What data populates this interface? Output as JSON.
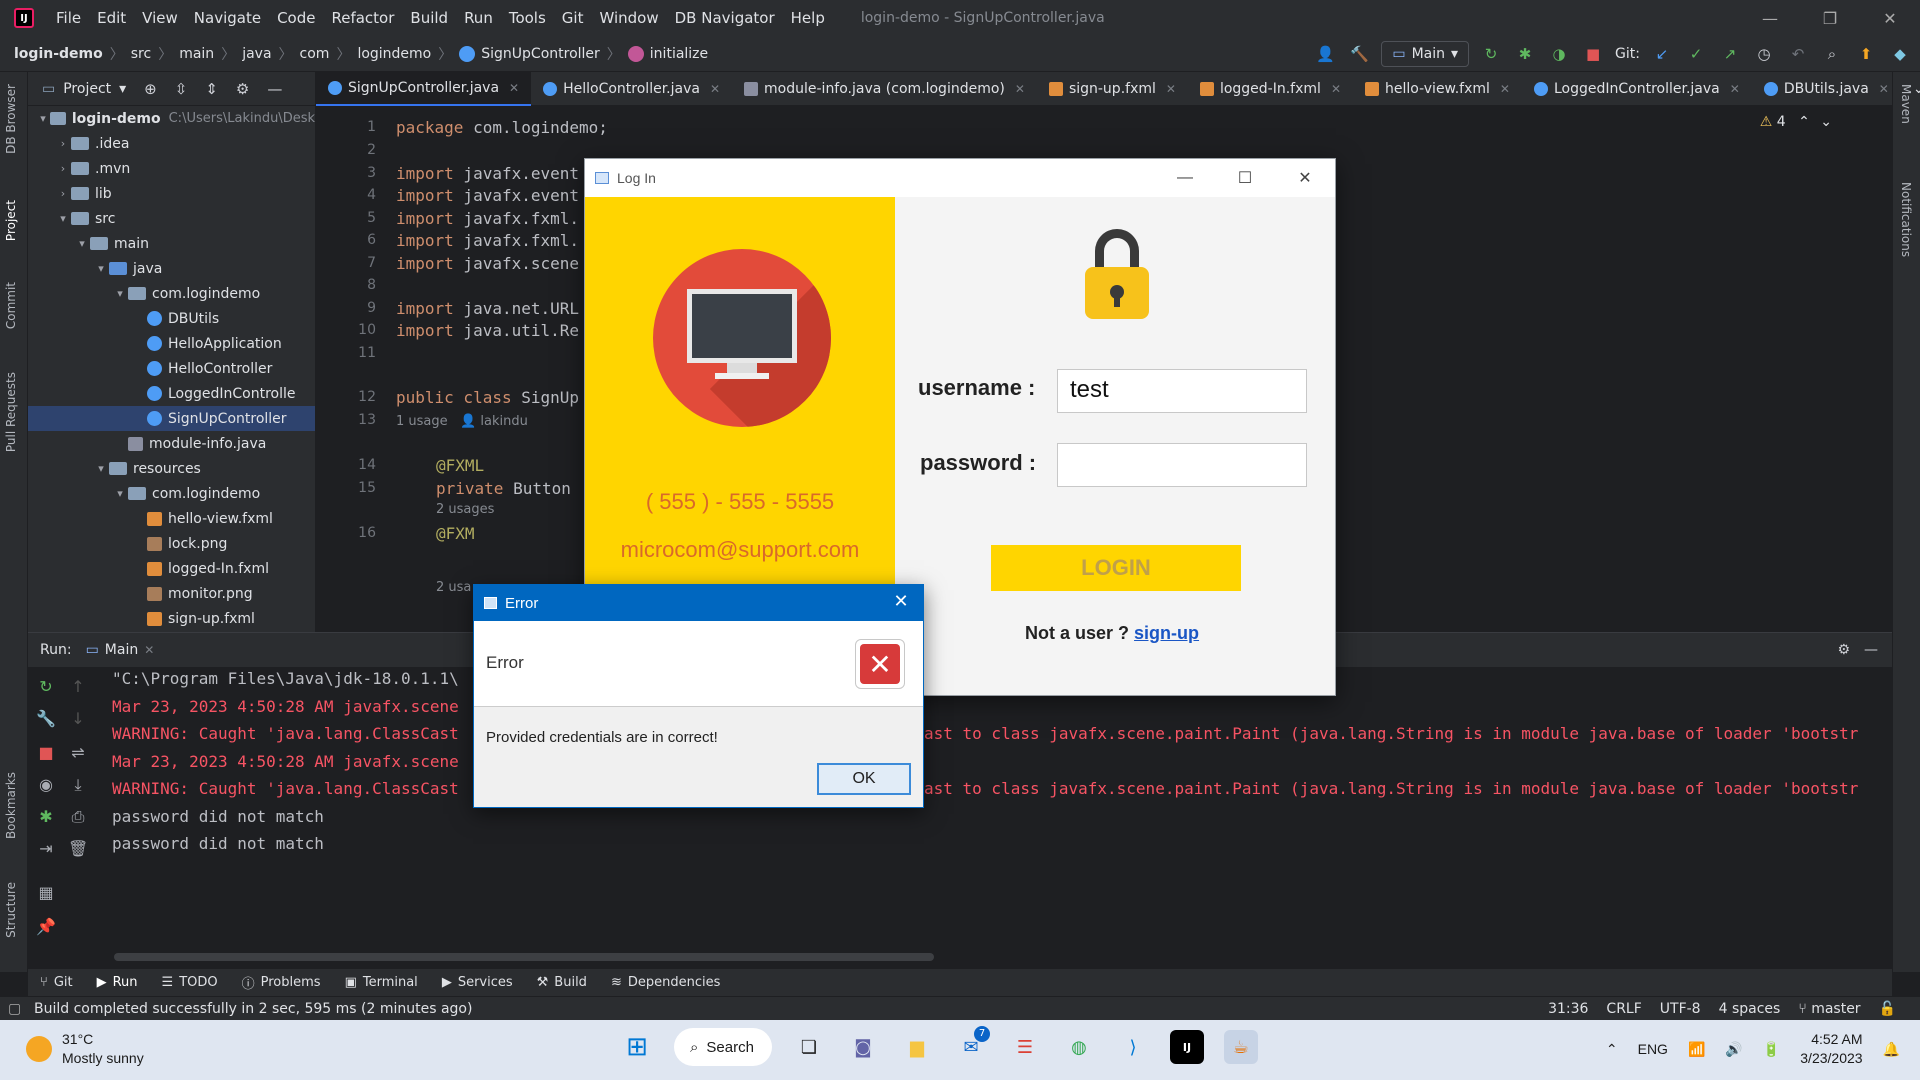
{
  "titlebar": {
    "app_icon": "IJ",
    "menu": [
      "File",
      "Edit",
      "View",
      "Navigate",
      "Code",
      "Refactor",
      "Build",
      "Run",
      "Tools",
      "Git",
      "Window",
      "DB Navigator",
      "Help"
    ],
    "title": "login-demo - SignUpController.java"
  },
  "navbar": {
    "crumbs": [
      "login-demo",
      "src",
      "main",
      "java",
      "com",
      "logindemo",
      "SignUpController",
      "initialize"
    ],
    "run_config": "Main",
    "git_label": "Git:"
  },
  "left_stripe": [
    "DB Browser",
    "Project",
    "Commit",
    "Pull Requests",
    "Bookmarks",
    "Structure"
  ],
  "right_stripe": [
    "Maven",
    "Notifications"
  ],
  "project": {
    "header": "Project",
    "tree": [
      {
        "label": "login-demo",
        "extra": "C:\\Users\\Lakindu\\Desk",
        "indent": 0,
        "arrow": "▾",
        "icon": "fold"
      },
      {
        "label": ".idea",
        "indent": 1,
        "arrow": "›",
        "icon": "fold"
      },
      {
        "label": ".mvn",
        "indent": 1,
        "arrow": "›",
        "icon": "fold"
      },
      {
        "label": "lib",
        "indent": 1,
        "arrow": "›",
        "icon": "fold"
      },
      {
        "label": "src",
        "indent": 1,
        "arrow": "▾",
        "icon": "fold"
      },
      {
        "label": "main",
        "indent": 2,
        "arrow": "▾",
        "icon": "fold"
      },
      {
        "label": "java",
        "indent": 3,
        "arrow": "▾",
        "icon": "foldblue"
      },
      {
        "label": "com.logindemo",
        "indent": 4,
        "arrow": "▾",
        "icon": "fold"
      },
      {
        "label": "DBUtils",
        "indent": 5,
        "arrow": "",
        "icon": "jc"
      },
      {
        "label": "HelloApplication",
        "indent": 5,
        "arrow": "",
        "icon": "jc"
      },
      {
        "label": "HelloController",
        "indent": 5,
        "arrow": "",
        "icon": "jc"
      },
      {
        "label": "LoggedInControlle",
        "indent": 5,
        "arrow": "",
        "icon": "jc"
      },
      {
        "label": "SignUpController",
        "indent": 5,
        "arrow": "",
        "icon": "jc",
        "selected": true
      },
      {
        "label": "module-info.java",
        "indent": 4,
        "arrow": "",
        "icon": "modi"
      },
      {
        "label": "resources",
        "indent": 3,
        "arrow": "▾",
        "icon": "fold"
      },
      {
        "label": "com.logindemo",
        "indent": 4,
        "arrow": "▾",
        "icon": "fold"
      },
      {
        "label": "hello-view.fxml",
        "indent": 5,
        "arrow": "",
        "icon": "fx"
      },
      {
        "label": "lock.png",
        "indent": 5,
        "arrow": "",
        "icon": "png"
      },
      {
        "label": "logged-In.fxml",
        "indent": 5,
        "arrow": "",
        "icon": "fx"
      },
      {
        "label": "monitor.png",
        "indent": 5,
        "arrow": "",
        "icon": "png"
      },
      {
        "label": "sign-up.fxml",
        "indent": 5,
        "arrow": "",
        "icon": "fx"
      }
    ]
  },
  "tabs": [
    {
      "label": "SignUpController.java",
      "icon": "class",
      "active": true
    },
    {
      "label": "HelloController.java",
      "icon": "class"
    },
    {
      "label": "module-info.java (com.logindemo)",
      "icon": "mod"
    },
    {
      "label": "sign-up.fxml",
      "icon": "fx"
    },
    {
      "label": "logged-In.fxml",
      "icon": "fx"
    },
    {
      "label": "hello-view.fxml",
      "icon": "fx"
    },
    {
      "label": "LoggedInController.java",
      "icon": "class"
    },
    {
      "label": "DBUtils.java",
      "icon": "class"
    }
  ],
  "editor": {
    "warnings": "4",
    "gutter": [
      "1",
      "2",
      "3",
      "4",
      "5",
      "6",
      "7",
      "8",
      "9",
      "10",
      "11",
      "12",
      "13",
      "14",
      "15",
      "16"
    ],
    "lines": [
      {
        "kw": "package",
        "rest": " com.logindemo;"
      },
      {
        "kw": "",
        "rest": ""
      },
      {
        "kw": "import",
        "rest": " javafx.event"
      },
      {
        "kw": "import",
        "rest": " javafx.event"
      },
      {
        "kw": "import",
        "rest": " javafx.fxml."
      },
      {
        "kw": "import",
        "rest": " javafx.fxml."
      },
      {
        "kw": "import",
        "rest": " javafx.scene"
      },
      {
        "kw": "",
        "rest": ""
      },
      {
        "kw": "import",
        "rest": " java.net.URL"
      },
      {
        "kw": "import",
        "rest": " java.util.Re"
      },
      {
        "kw": "",
        "rest": ""
      },
      {
        "kw": "public class",
        "rest": " SignUp"
      },
      {
        "kw": "",
        "rest": ""
      },
      {
        "kw": "",
        "ann": "@FXML",
        "rest": ""
      },
      {
        "kw": "private",
        "rest": " Button"
      },
      {
        "kw": "",
        "ann": "@FXM",
        "rest": ""
      }
    ],
    "hint1": "1 usage",
    "hint1_author": "lakindu",
    "hint2": "2 usages",
    "hint3": "2 usa"
  },
  "run": {
    "label": "Run:",
    "config": "Main",
    "output": [
      {
        "text": "\"C:\\Program Files\\Java\\jdk-18.0.1.1\\",
        "color": "gray"
      },
      {
        "text": "Mar 23, 2023 4:50:28 AM javafx.scene",
        "color": "red"
      },
      {
        "text": "WARNING: Caught 'java.lang.ClassCast",
        "tail": "ast to class javafx.scene.paint.Paint (java.lang.String is in module java.base of loader 'bootstr",
        "color": "red"
      },
      {
        "text": "Mar 23, 2023 4:50:28 AM javafx.scene",
        "color": "red"
      },
      {
        "text": "WARNING: Caught 'java.lang.ClassCast",
        "tail": "ast to class javafx.scene.paint.Paint (java.lang.String is in module java.base of loader 'bootstr",
        "color": "red"
      },
      {
        "text": "password did not match",
        "color": "gray"
      },
      {
        "text": "password did not match",
        "color": "gray"
      }
    ]
  },
  "tooltabs": [
    "Git",
    "Run",
    "TODO",
    "Problems",
    "Terminal",
    "Services",
    "Build",
    "Dependencies"
  ],
  "status": {
    "message": "Build completed successfully in 2 sec, 595 ms (2 minutes ago)",
    "position": "31:36",
    "line_sep": "CRLF",
    "encoding": "UTF-8",
    "indent": "4 spaces",
    "branch": "master"
  },
  "login_window": {
    "title": "Log In",
    "phone": "( 555 ) - 555 - 5555",
    "email": "microcom@support.com",
    "username_label": "username :",
    "username_value": "test",
    "password_label": "password :",
    "password_value": "",
    "login_button": "LOGIN",
    "not_user": "Not a user ?",
    "signup_link": "sign-up"
  },
  "error_dialog": {
    "title": "Error",
    "header": "Error",
    "message": "Provided credentials are in correct!",
    "ok": "OK"
  },
  "taskbar": {
    "temp": "31°C",
    "weather": "Mostly sunny",
    "search": "Search",
    "mail_badge": "7",
    "lang": "ENG",
    "time": "4:52 AM",
    "date": "3/23/2023"
  },
  "colors": {
    "accent": "#3574f0",
    "login_yellow": "#ffd500",
    "error_red": "#f75464",
    "win_blue": "#0067c0"
  }
}
